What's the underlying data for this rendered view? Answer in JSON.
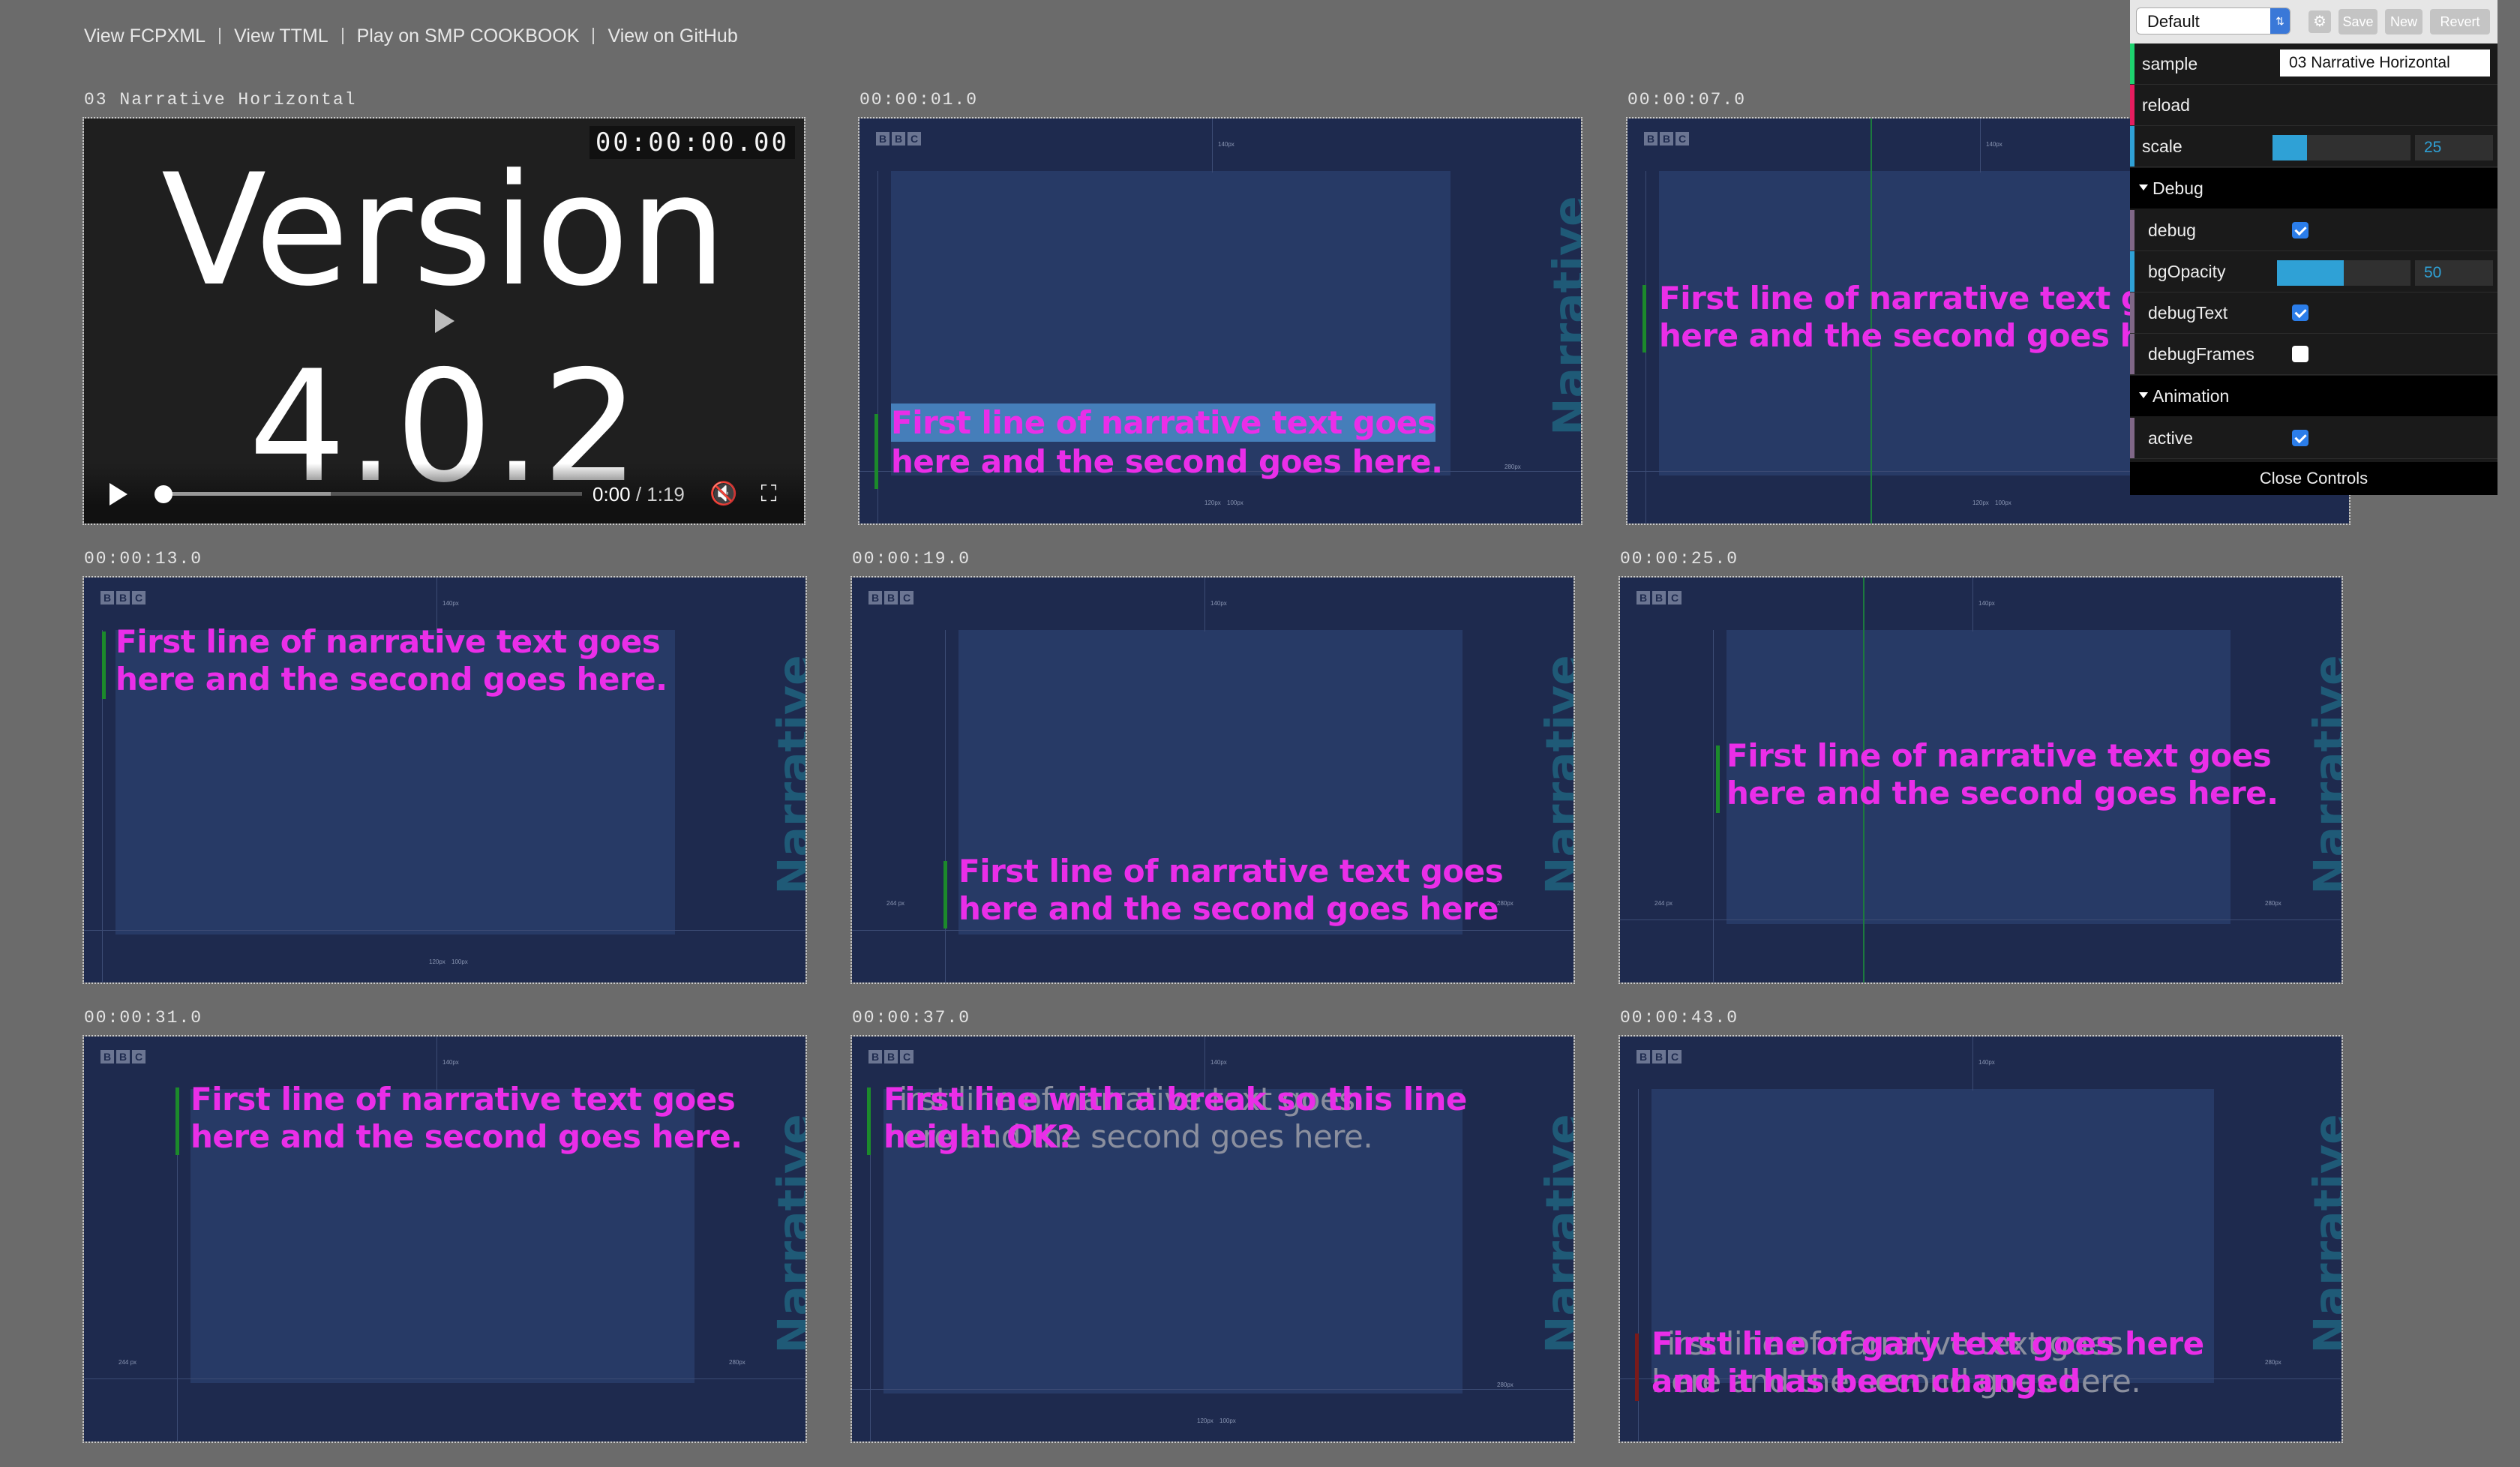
{
  "nav": {
    "links": [
      "View FCPXML",
      "View TTML",
      "Play on SMP COOKBOOK",
      "View on GitHub"
    ]
  },
  "video": {
    "label": "03 Narrative Horizontal",
    "timecode": "00:00:00.00",
    "title_line1": "Version",
    "title_line2": "4.0.2",
    "current_time": "0:00",
    "duration": "/ 1:19",
    "progress": 0,
    "buffered": 0.4
  },
  "frames": [
    {
      "label": "00:00:01.0"
    },
    {
      "label": "00:00:07.0"
    },
    {
      "label": "00:00:13.0"
    },
    {
      "label": "00:00:19.0"
    },
    {
      "label": "00:00:25.0"
    },
    {
      "label": "00:00:31.0"
    },
    {
      "label": "00:00:37.0"
    },
    {
      "label": "00:00:43.0"
    }
  ],
  "bbc_letters": [
    "B",
    "B",
    "C"
  ],
  "side_text": "Narrative",
  "caption": {
    "line1": "First line of narrative text goes",
    "line2": "here and the second goes here.",
    "line2_no_period": "here and the second goes here",
    "overlap_a_line1": "First line with a break so this line",
    "overlap_a_line2": "height OK?",
    "overlap_b_line1": "First line of gary text goes here",
    "overlap_b_line2": "and it has been changed"
  },
  "rulers": [
    "140px",
    "120px",
    "100px",
    "244 px",
    "280px",
    "170px",
    "1/2",
    "1/2 px"
  ],
  "gui": {
    "preset": "Default",
    "save": "Save",
    "new": "New",
    "revert": "Revert",
    "sample_label": "sample",
    "sample_value": "03 Narrative Horizontal",
    "reload_label": "reload",
    "scale_label": "scale",
    "scale_value": "25",
    "scale_fraction": 0.25,
    "debug_folder": "Debug",
    "debug_label": "debug",
    "debug_checked": true,
    "bgopacity_label": "bgOpacity",
    "bgopacity_value": "50",
    "bgopacity_fraction": 0.5,
    "debugtext_label": "debugText",
    "debugtext_checked": true,
    "debugframes_label": "debugFrames",
    "debugframes_checked": false,
    "animation_folder": "Animation",
    "active_label": "active",
    "active_checked": true,
    "close_label": "Close Controls",
    "colors": {
      "string": "#1ed36f",
      "function": "#e61d5f",
      "number": "#2fa1d6",
      "boolean": "#806787",
      "accent": "#2fa1d6"
    }
  },
  "colors": {
    "page_bg": "#6b6b6b",
    "frame_bg": "#1e2a4e",
    "caption": "#ea2ee8",
    "side_text": "#1f5a77"
  }
}
